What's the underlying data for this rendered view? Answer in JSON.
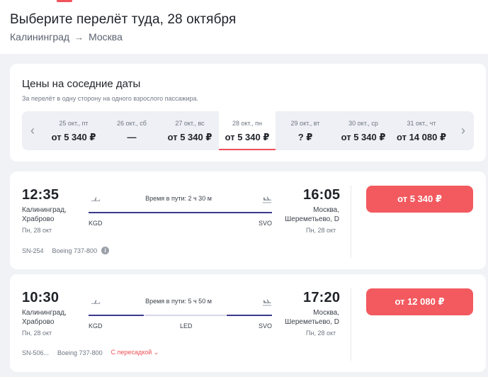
{
  "header": {
    "title": "Выберите перелёт туда, 28 октября",
    "from_city": "Калининград",
    "to_city": "Москва",
    "arrow": "→"
  },
  "nearby_dates": {
    "title": "Цены на соседние даты",
    "subtitle": "За перелёт в одну сторону на одного взрослого пассажира.",
    "prev_icon": "‹",
    "next_icon": "›",
    "items": [
      {
        "date": "25 окт., пт",
        "price": "от 5 340 ₽",
        "selected": false
      },
      {
        "date": "26 окт., сб",
        "price": "—",
        "selected": false
      },
      {
        "date": "27 окт., вс",
        "price": "от 5 340 ₽",
        "selected": false
      },
      {
        "date": "28 окт., пн",
        "price": "от 5 340 ₽",
        "selected": true
      },
      {
        "date": "29 окт., вт",
        "price": "? ₽",
        "selected": false
      },
      {
        "date": "30 окт., ср",
        "price": "от 5 340 ₽",
        "selected": false
      },
      {
        "date": "31 окт., чт",
        "price": "от 14 080 ₽",
        "selected": false
      }
    ]
  },
  "flights": [
    {
      "dep_time": "12:35",
      "dep_city_1": "Калининград,",
      "dep_city_2": "Храброво",
      "dep_date": "Пн, 28 окт",
      "duration": "Время в пути: 2 ч 30 м",
      "origin_code": "KGD",
      "dest_code": "SVO",
      "arr_time": "16:05",
      "arr_city_1": "Москва,",
      "arr_city_2": "Шереметьево, D",
      "arr_date": "Пн, 28 окт",
      "flight_no": "SN-254",
      "aircraft": "Boeing 737-800",
      "price": "от 5 340 ₽"
    },
    {
      "dep_time": "10:30",
      "dep_city_1": "Калининград,",
      "dep_city_2": "Храброво",
      "dep_date": "Пн, 28 окт",
      "duration": "Время в пути: 5 ч 50 м",
      "origin_code": "KGD",
      "stop_code": "LED",
      "dest_code": "SVO",
      "arr_time": "17:20",
      "arr_city_1": "Москва,",
      "arr_city_2": "Шереметьево, D",
      "arr_date": "Пн, 28 окт",
      "flight_no": "SN-506...",
      "aircraft": "Boeing 737-800",
      "transfer": "С пересадкой",
      "price": "от 12 080 ₽"
    }
  ],
  "colors": {
    "accent": "#f25a5f",
    "route_line": "#3a3a8c",
    "transfer_text": "#ef4f57"
  }
}
